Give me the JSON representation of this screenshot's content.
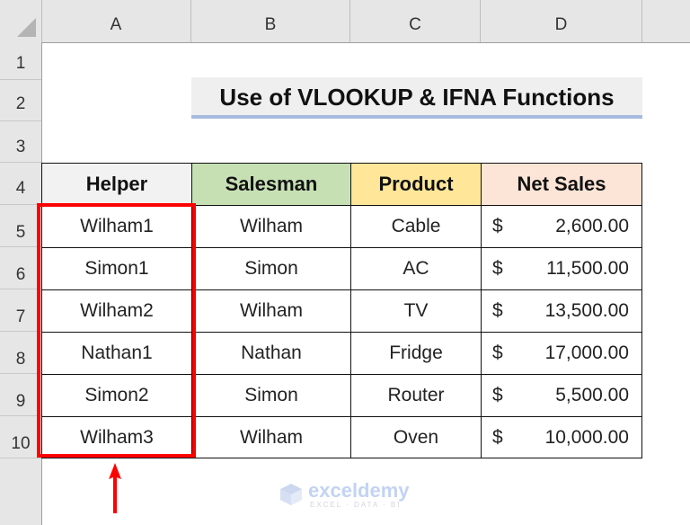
{
  "spreadsheet": {
    "column_headers": [
      "A",
      "B",
      "C",
      "D"
    ],
    "row_headers": [
      "1",
      "2",
      "3",
      "4",
      "5",
      "6",
      "7",
      "8",
      "9",
      "10"
    ],
    "title": "Use of VLOOKUP & IFNA Functions",
    "table": {
      "headers": [
        "Helper",
        "Salesman",
        "Product",
        "Net Sales"
      ],
      "header_colors": [
        "#f2f2f2",
        "#c6e0b4",
        "#ffe699",
        "#fce4d6"
      ],
      "rows": [
        {
          "helper": "Wilham1",
          "salesman": "Wilham",
          "product": "Cable",
          "currency": "$",
          "net_sales": "2,600.00"
        },
        {
          "helper": "Simon1",
          "salesman": "Simon",
          "product": "AC",
          "currency": "$",
          "net_sales": "11,500.00"
        },
        {
          "helper": "Wilham2",
          "salesman": "Wilham",
          "product": "TV",
          "currency": "$",
          "net_sales": "13,500.00"
        },
        {
          "helper": "Nathan1",
          "salesman": "Nathan",
          "product": "Fridge",
          "currency": "$",
          "net_sales": "17,000.00"
        },
        {
          "helper": "Simon2",
          "salesman": "Simon",
          "product": "Router",
          "currency": "$",
          "net_sales": "5,500.00"
        },
        {
          "helper": "Wilham3",
          "salesman": "Wilham",
          "product": "Oven",
          "currency": "$",
          "net_sales": "10,000.00"
        }
      ]
    },
    "highlight_color": "#ff0000",
    "select_all_icon": "select-all-triangle",
    "annotation_icon": "up-arrow"
  },
  "watermark": {
    "name": "exceldemy",
    "tagline": "EXCEL · DATA · BI"
  }
}
